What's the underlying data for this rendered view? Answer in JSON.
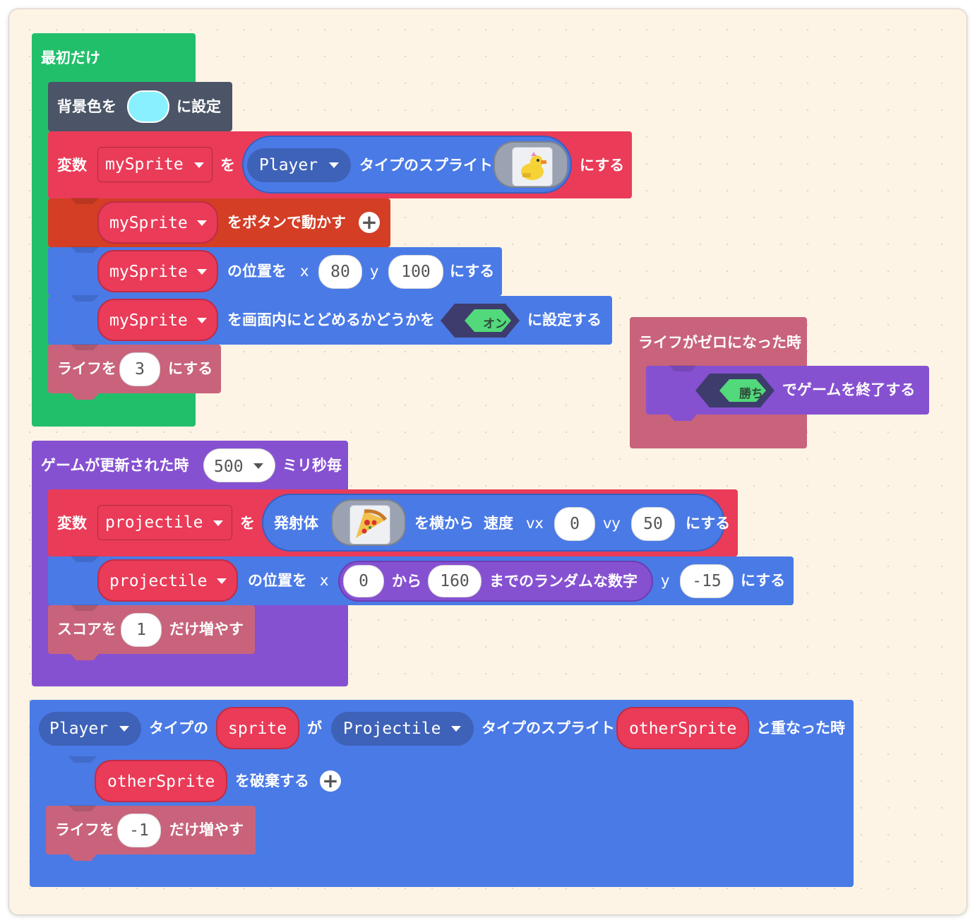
{
  "colors": {
    "loops": "#22bf6b",
    "scene": "#4b5567",
    "sprites": "#ea3b58",
    "controller": "#d33e25",
    "position": "#4a7ae6",
    "info": "#c8637b",
    "game": "#8651d1",
    "toggle_dark": "#3e3c6c",
    "toggle_green": "#52d97b",
    "bg_color_value": "#88f0ff"
  },
  "on_start": {
    "hat_label": "最初だけ",
    "set_bg": {
      "prefix": "背景色を",
      "suffix": "に設定"
    },
    "create_sprite": {
      "var_label": "変数",
      "var_name": "mySprite",
      "wo": "を",
      "kind": "Player",
      "kind_suffix": "タイプのスプライト",
      "image": "duck-sprite-icon",
      "suffix": "にする"
    },
    "move_with_buttons": {
      "var_name": "mySprite",
      "text": "をボタンで動かす"
    },
    "set_position": {
      "var_name": "mySprite",
      "text": "の位置を",
      "x_label": "x",
      "x": "80",
      "y_label": "y",
      "y": "100",
      "suffix": "にする"
    },
    "stay_in_screen": {
      "var_name": "mySprite",
      "text": "を画面内にとどめるかどうかを",
      "toggle": "オン",
      "suffix": "に設定する"
    },
    "set_life": {
      "prefix": "ライフを",
      "value": "3",
      "suffix": "にする"
    }
  },
  "life_zero": {
    "hat_label": "ライフがゼロになった時",
    "game_over": {
      "toggle": "勝ち",
      "text": "でゲームを終了する"
    }
  },
  "on_update": {
    "hat_prefix": "ゲームが更新された時",
    "interval": "500",
    "hat_suffix": "ミリ秒毎",
    "create_projectile": {
      "var_label": "変数",
      "var_name": "projectile",
      "wo": "を",
      "inner_label": "発射体",
      "image": "pizza-sprite-icon",
      "from_side": "を横から",
      "speed": "速度",
      "vx_label": "vx",
      "vx": "0",
      "vy_label": "vy",
      "vy": "50",
      "suffix": "にする"
    },
    "set_position": {
      "var_name": "projectile",
      "text": "の位置を",
      "x_label": "x",
      "random_from": "0",
      "random_kara": "から",
      "random_to": "160",
      "random_suffix": "までのランダムな数字",
      "y_label": "y",
      "y": "-15",
      "suffix": "にする"
    },
    "change_score": {
      "prefix": "スコアを",
      "value": "1",
      "suffix": "だけ増やす"
    }
  },
  "on_overlap": {
    "kind1": "Player",
    "kind1_suffix": "タイプの",
    "var1": "sprite",
    "ga": "が",
    "kind2": "Projectile",
    "kind2_suffix": "タイプのスプライト",
    "var2": "otherSprite",
    "suffix": "と重なった時",
    "destroy": {
      "var_name": "otherSprite",
      "text": "を破棄する"
    },
    "change_life": {
      "prefix": "ライフを",
      "value": "-1",
      "suffix": "だけ増やす"
    }
  }
}
